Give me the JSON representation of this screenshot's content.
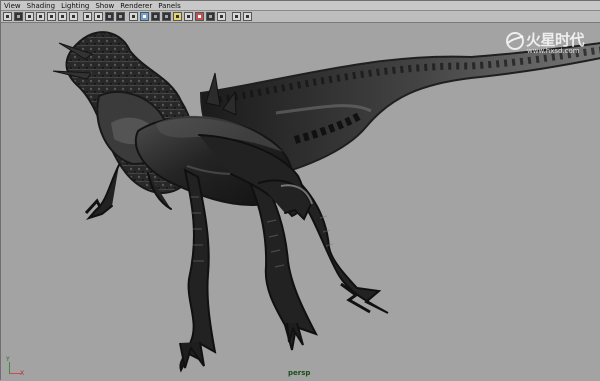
{
  "menu": [
    "View",
    "Shading",
    "Lighting",
    "Show",
    "Renderer",
    "Panels"
  ],
  "toolbar": {
    "icons": [
      "select-icon",
      "camera-icon",
      "bookmark-icon",
      "gear-icon",
      "grid-icon",
      "sphere-icon",
      "light-icon",
      "stop-icon",
      "isolate-icon",
      "brush-icon"
    ]
  },
  "viewport": {
    "camera_name": "persp",
    "axis_x": "X",
    "axis_y": "Y"
  },
  "logo": {
    "text": "火星时代",
    "url": "www.hxsd.com"
  }
}
